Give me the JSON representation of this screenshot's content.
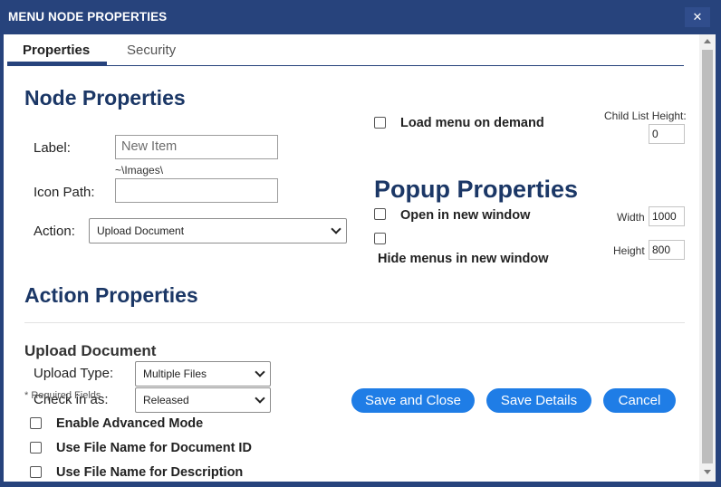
{
  "window": {
    "title": "MENU NODE PROPERTIES",
    "close_glyph": "✕"
  },
  "tabs": [
    {
      "label": "Properties",
      "active": true
    },
    {
      "label": "Security",
      "active": false
    }
  ],
  "node": {
    "heading": "Node Properties",
    "label_label": "Label:",
    "label_placeholder": "New Item",
    "icon_hint": "~\\Images\\",
    "icon_path_label": "Icon Path:",
    "icon_path_value": "",
    "action_label": "Action:",
    "action_value": "Upload Document"
  },
  "menu": {
    "load_on_demand_label": "Load menu on demand",
    "load_on_demand_checked": false,
    "child_list_height_label": "Child List Height:",
    "child_list_height_value": "0"
  },
  "popup": {
    "heading": "Popup Properties",
    "open_new_window_label": "Open in new window",
    "open_new_window_checked": false,
    "hide_menus_label": "Hide menus in new window",
    "hide_menus_checked": false,
    "width_label": "Width",
    "width_value": "1000",
    "height_label": "Height",
    "height_value": "800"
  },
  "action": {
    "heading": "Action Properties",
    "subheading": "Upload Document",
    "upload_type_label": "Upload Type:",
    "upload_type_value": "Multiple Files",
    "check_in_label": "Check in as:",
    "check_in_value": "Released",
    "required_note": "* Required Fields",
    "options": [
      {
        "label": "Enable Advanced Mode",
        "checked": false
      },
      {
        "label": "Use File Name for Document ID",
        "checked": false
      },
      {
        "label": "Use File Name for Description",
        "checked": false
      }
    ]
  },
  "buttons": {
    "save_close": "Save and Close",
    "save_details": "Save Details",
    "cancel": "Cancel"
  },
  "colors": {
    "titlebar": "#27437c",
    "heading": "#1b3766",
    "button": "#1f7de6"
  },
  "icons": {
    "close": "close-icon",
    "checkbox": "checkbox-icon",
    "chevron": "chevron-down-icon",
    "scroll_up": "arrow-up-icon",
    "scroll_down": "arrow-down-icon"
  }
}
